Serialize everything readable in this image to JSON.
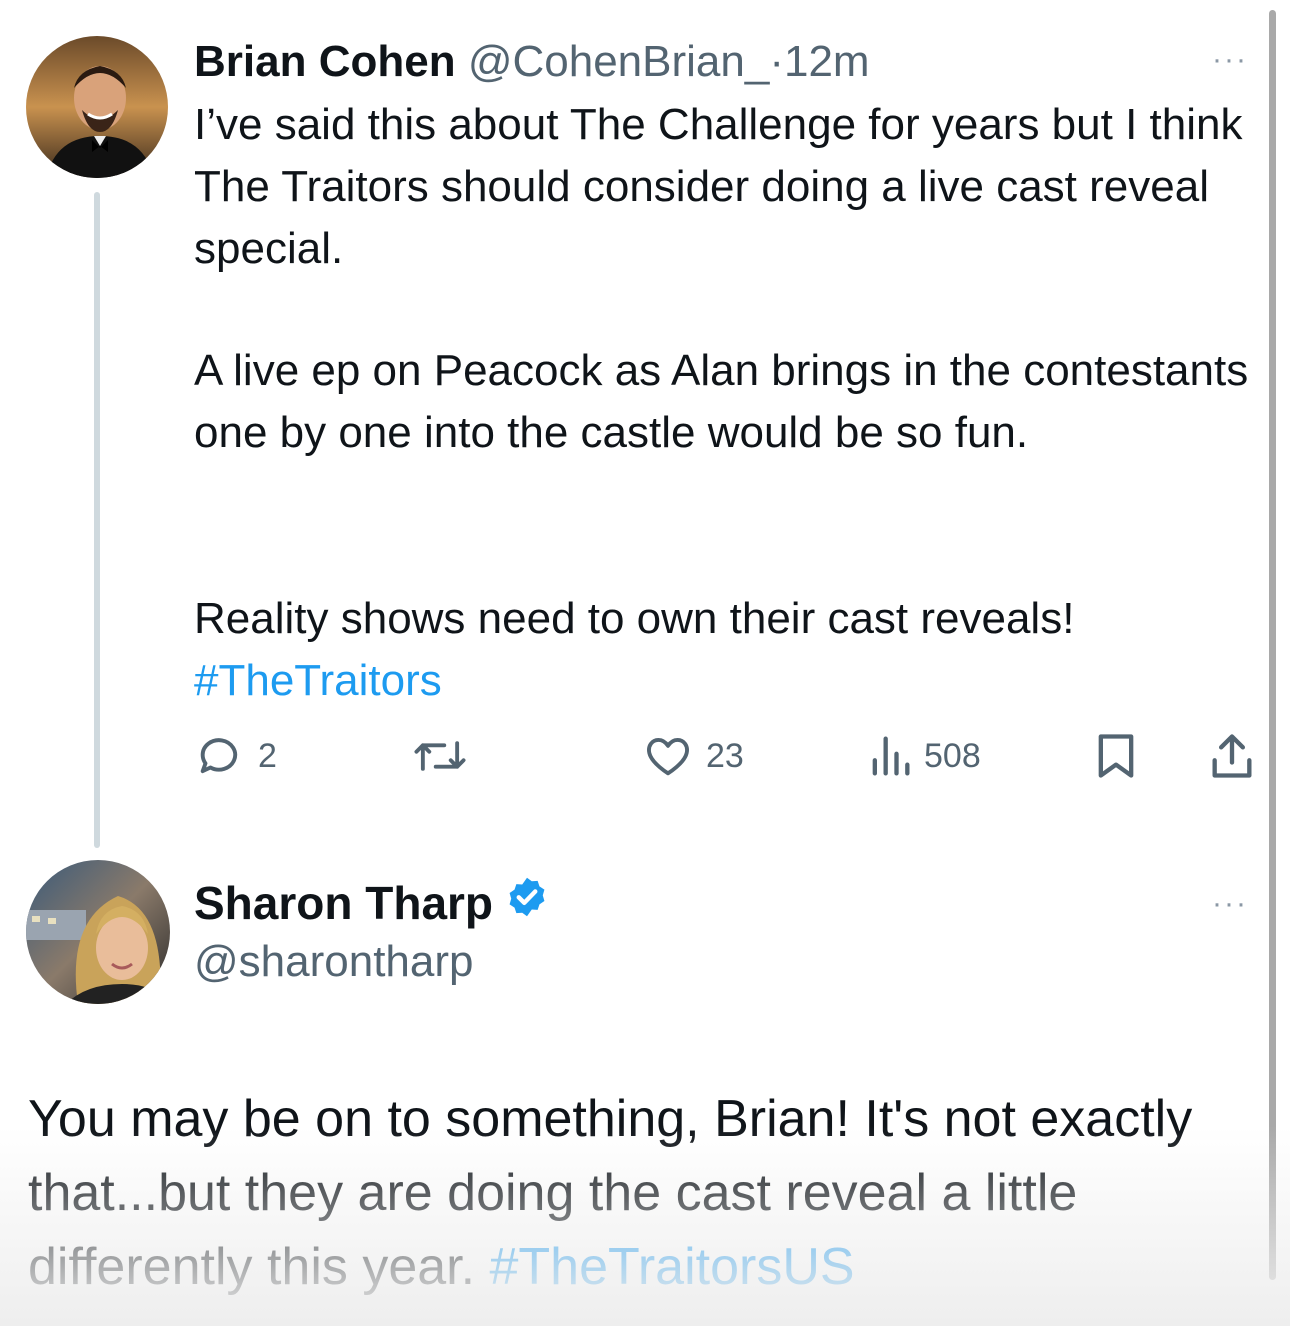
{
  "tweet": {
    "author_name": "Brian Cohen",
    "author_handle": "@CohenBrian_",
    "separator": "·",
    "time": "12m",
    "more": "···",
    "paragraphs": [
      "I’ve said this about The Challenge for years but I think The Traitors should consider doing a live cast reveal special.",
      "A live ep on Peacock as Alan brings in the contestants one by one into the castle would be so fun.",
      "Reality shows need to own their cast reveals!"
    ],
    "hashtag": "#TheTraitors",
    "actions": {
      "replies": "2",
      "retweets": "",
      "likes": "23",
      "views": "508"
    }
  },
  "reply": {
    "author_name": "Sharon Tharp",
    "verified": true,
    "author_handle": "@sharontharp",
    "more": "···",
    "text": "You may be on to something, Brian! It's not exactly that...but they are doing the cast reveal a little differently this year. ",
    "hashtag": "#TheTraitorsUS"
  },
  "colors": {
    "accent": "#1d9bf0",
    "text": "#0f1419",
    "muted": "#536471"
  }
}
